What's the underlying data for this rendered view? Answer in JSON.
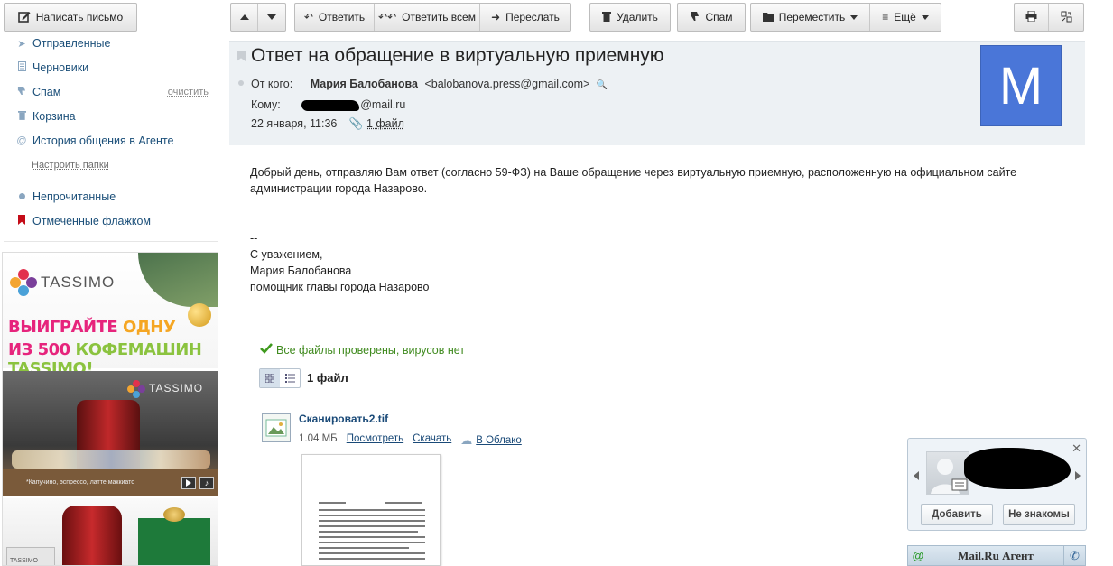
{
  "toolbar": {
    "compose": "Написать письмо",
    "reply": "Ответить",
    "reply_all": "Ответить всем",
    "forward": "Переслать",
    "delete": "Удалить",
    "spam": "Спам",
    "move": "Переместить",
    "more": "Ещё"
  },
  "sidebar": {
    "sent": "Отправленные",
    "drafts": "Черновики",
    "spam": "Спам",
    "spam_clean": "очистить",
    "trash": "Корзина",
    "agent_history": "История общения в Агенте",
    "configure": "Настроить папки",
    "unread": "Непрочитанные",
    "flagged": "Отмеченные флажком"
  },
  "ad": {
    "brand1": "TASSIMO",
    "line1a": "ВЫИГРАЙТЕ",
    "line1b": "ОДНУ",
    "line2a": "ИЗ 500",
    "line2b": "КОФЕМАШИН TASSIMO!",
    "brand2": "TASSIMO",
    "caption": "*Капучино, эспрессо, латте маккиато",
    "brand3": "TASSIMO"
  },
  "message": {
    "subject": "Ответ на обращение в виртуальную приемную",
    "from_label": "От кого:",
    "from_name": "Мария Балобанова",
    "from_email": "<balobanova.press@gmail.com>",
    "to_label": "Кому:",
    "to_email": "@mail.ru",
    "date": "22 января, 11:36",
    "attach_link": "1 файл",
    "avatar_letter": "M",
    "body_line1": "Добрый день, отправляю Вам ответ (согласно 59-ФЗ) на Ваше обращение через виртуальную приемную, расположенную на официальном сайте",
    "body_line2": "администрации города Назарово.",
    "sig_dash": "--",
    "sig_regards": "С уважением,",
    "sig_name": "Мария Балобанова",
    "sig_title": "помощник главы города Назарово"
  },
  "attachments": {
    "virus_status": "Все файлы проверены, вирусов нет",
    "count_label": "1 файл",
    "file_name": "Сканировать2.tif",
    "file_size": "1.04 МБ",
    "view": "Посмотреть",
    "download": "Скачать",
    "cloud": "В Облако"
  },
  "agent": {
    "add": "Добавить",
    "not_known": "Не знакомы",
    "title": "Mail.Ru Агент"
  },
  "colors": {
    "avatar_bg": "#4a76d8",
    "header_bg": "#edf1f4",
    "link": "#1a4a78",
    "virus_ok": "#3f8a1e"
  }
}
